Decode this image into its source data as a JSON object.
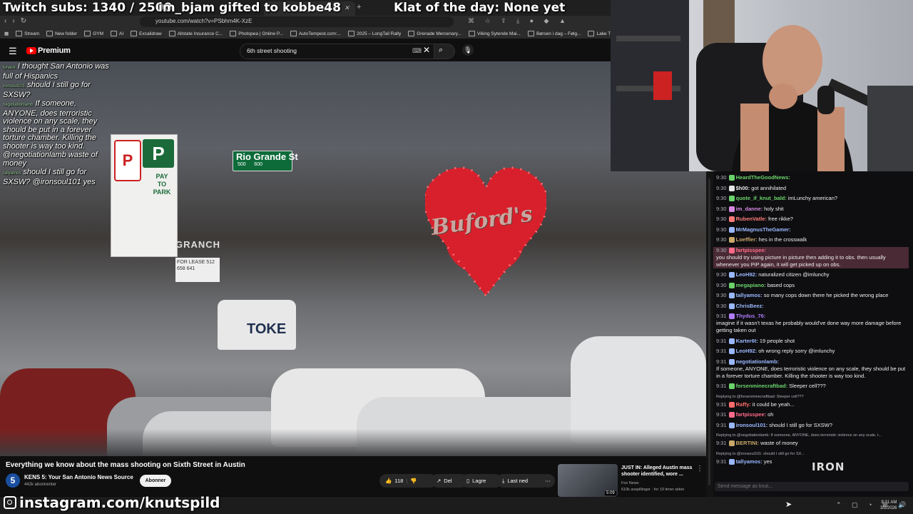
{
  "overlay": {
    "subs": "Twitch subs: 1340 / 2500",
    "gift": "im_bjam gifted to kobbe48",
    "klat": "Klat of the day: None yet",
    "instagram": "instagram.com/knutspild"
  },
  "browser": {
    "tab_title": "Everything we know about th",
    "url": "youtube.com/watch?v=PSbhm4K-XzE",
    "bookmarks": [
      "Stream",
      "New folder",
      "GYM",
      "AI",
      "Excalidraw",
      "Allstate Insurance C...",
      "Photopea | Online P...",
      "AutoTempest.com:...",
      "2025 – LongTail Rally",
      "Grenade Mercenary...",
      "Viking Sytende Mai...",
      "Børsen i dag – Følg...",
      "Lake Travis Pontoon..."
    ]
  },
  "youtube": {
    "logo_label": "Premium",
    "search_value": "6th street shooting",
    "video": {
      "street_sign_name": "Rio Grande St",
      "street_sign_num": "500      600",
      "pay_to_park": "PAY TO PARK",
      "building_name": "GRANCH",
      "lease_sign": "FOR LEASE 512 658 641",
      "van_text": "TOKE",
      "heart_sign": "Buford's"
    },
    "title": "Everything we know about the mass shooting on Sixth Street in Austin",
    "channel": "KENS 5: Your San Antonio News Source",
    "subscribers": "442k abonnenter",
    "subscribe_label": "Abonner",
    "likes": "118",
    "share_label": "Del",
    "save_label": "Lagre",
    "download_label": "Last ned",
    "recommended": {
      "title": "JUST IN: Alleged Austin mass shooter identified, wore ...",
      "channel": "Fox News",
      "views": "610k avspillinger · for 19 timer siden",
      "duration": "5:09"
    }
  },
  "stream_chat_overlay": [
    {
      "name": "lunace",
      "text": "I thought San Antonio was full of Hispanics"
    },
    {
      "name": "ironsoul101",
      "text": "should I still go for SXSW?"
    },
    {
      "name": "negotiationlamb",
      "text": "If someone, ANYONE, does terroristic violence on any scale, they should be put in a forever torture chamber. Killing the shooter is way too kind."
    },
    {
      "name": "",
      "text": "@negotiationlamb waste of money"
    },
    {
      "name": "tallyamos",
      "text": "should I still go for SXSW? @ironsoul101 yes"
    }
  ],
  "twitch_chat": [
    {
      "time": "9:30",
      "user": "HeardTheGoodNews:",
      "text": "",
      "color": "#6bd26b"
    },
    {
      "time": "9:30",
      "user": "$h00:",
      "text": "got annihilated",
      "color": "#e6e6e6"
    },
    {
      "time": "9:30",
      "user": "quote_if_knut_bald:",
      "text": "imLunchy american?",
      "color": "#6bd26b"
    },
    {
      "time": "9:30",
      "user": "im_danne:",
      "text": "holy shit",
      "color": "#d48ae0"
    },
    {
      "time": "9:30",
      "user": "RubenVatle:",
      "text": "free rikke?",
      "color": "#ff7a7a"
    },
    {
      "time": "9:30",
      "user": "MrMagnusTheGamer:",
      "text": "",
      "color": "#9ab8ff"
    },
    {
      "time": "9:30",
      "user": "Loeffler:",
      "text": "hes in the crosswalk",
      "color": "#c9a86a"
    },
    {
      "time": "9:30",
      "user": "fartpisspee:",
      "text": "you should try using picture in picture then adding it to obs. then usually whenever you PiP again, it will get picked up on obs.",
      "color": "#ff6b8a",
      "highlight": true
    },
    {
      "time": "9:30",
      "user": "LeoH92:",
      "text": "naturalized citizen @imlunchy",
      "color": "#9ab8ff"
    },
    {
      "time": "9:30",
      "user": "megapiano:",
      "text": "based cops",
      "color": "#6bd26b"
    },
    {
      "time": "9:30",
      "user": "tallyamos:",
      "text": "so many cops down there he picked the wrong place",
      "color": "#9ab8ff"
    },
    {
      "time": "9:30",
      "user": "ChrisBeez:",
      "text": "",
      "color": "#9ab8ff"
    },
    {
      "time": "9:31",
      "user": "Thydus_76:",
      "text": "imagine if it wasn't texas he probably would've done way more damage before getting taken out",
      "color": "#b07cff"
    },
    {
      "time": "9:31",
      "user": "Karter6t:",
      "text": "19 people shot",
      "color": "#9ab8ff"
    },
    {
      "time": "9:31",
      "user": "LeoH92:",
      "text": "oh wrong reply sorry @imlunchy",
      "color": "#9ab8ff"
    },
    {
      "time": "9:31",
      "user": "negotiationlamb:",
      "text": "If someone, ANYONE, does terroristic violence on any scale, they should be put in a forever torture chamber. Killing the shooter is way too kind.",
      "color": "#9ab8ff"
    },
    {
      "time": "9:31",
      "user": "forsenminecraftbad:",
      "text": "Sleeper cell???",
      "color": "#6bd26b"
    },
    {
      "time": "9:31",
      "user": "Raffy:",
      "text": "it could be yeah...",
      "color": "#ff6b6b",
      "reply": "Replying to @forsenminecraftbad: Sleeper cell???"
    },
    {
      "time": "9:31",
      "user": "fartpisspee:",
      "text": "oh",
      "color": "#ff6b8a"
    },
    {
      "time": "9:31",
      "user": "ironsoul101:",
      "text": "should I still go for SXSW?",
      "color": "#9ab8ff"
    },
    {
      "time": "9:31",
      "user": "BERTINI:",
      "text": "waste of money",
      "color": "#c9a86a",
      "reply": "Replying to @negotiationlamb: If someone, ANYONE, does terroristic violence on any scale, t..."
    },
    {
      "time": "9:31",
      "user": "tallyamos:",
      "text": "yes",
      "color": "#9ab8ff",
      "reply": "Replying to @ironsoul101: should I still go for SX..."
    }
  ],
  "chat_input_placeholder": "Send message as knut...",
  "chat_logo": "IRON",
  "taskbar": {
    "time": "9:31 AM",
    "date": "3/2/2026"
  },
  "colors": {
    "youtube_red": "#ff0000",
    "twitch_bg": "#0e0e10",
    "heart_sign": "#d8202c"
  }
}
